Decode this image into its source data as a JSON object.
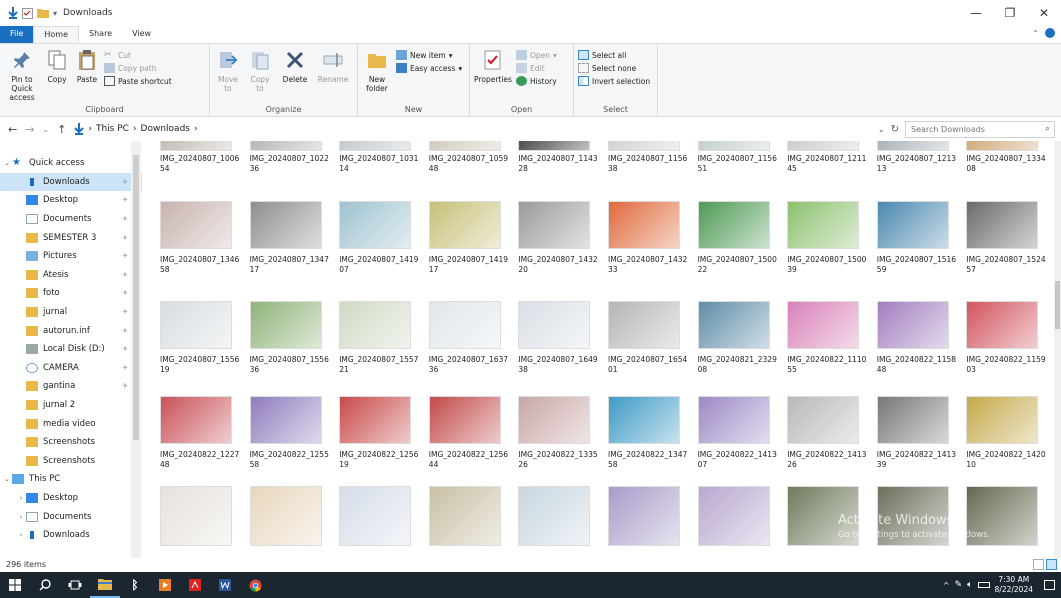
{
  "window": {
    "title": "Downloads"
  },
  "tabs": [
    "File",
    "Home",
    "Share",
    "View"
  ],
  "ribbon": {
    "clipboard": {
      "name": "Clipboard",
      "pin": "Pin to Quick access",
      "copy": "Copy",
      "paste": "Paste",
      "cut": "Cut",
      "copy_path": "Copy path",
      "paste_shortcut": "Paste shortcut"
    },
    "organize": {
      "name": "Organize",
      "move_to": "Move to",
      "copy_to": "Copy to",
      "delete": "Delete",
      "rename": "Rename"
    },
    "new": {
      "name": "New",
      "new_folder": "New folder",
      "new_item": "New item",
      "easy_access": "Easy access"
    },
    "open": {
      "name": "Open",
      "properties": "Properties",
      "open": "Open",
      "edit": "Edit",
      "history": "History"
    },
    "select": {
      "name": "Select",
      "select_all": "Select all",
      "select_none": "Select none",
      "invert_selection": "Invert selection"
    }
  },
  "address": {
    "path": [
      "This PC",
      "Downloads"
    ],
    "search_placeholder": "Search Downloads"
  },
  "nav_pane": [
    {
      "label": "Quick access",
      "icon": "star-icon",
      "level": 0,
      "expand": "v"
    },
    {
      "label": "Downloads",
      "icon": "download-icon",
      "level": 1,
      "pinned": true,
      "selected": true
    },
    {
      "label": "Desktop",
      "icon": "desktop-icon",
      "level": 1,
      "pinned": true
    },
    {
      "label": "Documents",
      "icon": "documents-icon",
      "level": 1,
      "pinned": true
    },
    {
      "label": "SEMESTER 3",
      "icon": "folder-icon",
      "level": 1,
      "pinned": true
    },
    {
      "label": "Pictures",
      "icon": "pictures-icon",
      "level": 1,
      "pinned": true
    },
    {
      "label": "Atesis",
      "icon": "folder-icon",
      "level": 1,
      "pinned": true
    },
    {
      "label": "foto",
      "icon": "folder-icon",
      "level": 1,
      "pinned": true
    },
    {
      "label": "jurnal",
      "icon": "folder-icon",
      "level": 1,
      "pinned": true
    },
    {
      "label": "autorun.inf",
      "icon": "folder-icon",
      "level": 1,
      "pinned": true
    },
    {
      "label": "Local Disk (D:)",
      "icon": "drive-icon",
      "level": 1,
      "pinned": true
    },
    {
      "label": "CAMERA",
      "icon": "search-folder-icon",
      "level": 1,
      "pinned": true
    },
    {
      "label": "gantina",
      "icon": "folder-icon",
      "level": 1,
      "pinned": true
    },
    {
      "label": "jurnal 2",
      "icon": "folder-icon",
      "level": 1
    },
    {
      "label": "media video",
      "icon": "folder-icon",
      "level": 1
    },
    {
      "label": "Screenshots",
      "icon": "folder-icon",
      "level": 1
    },
    {
      "label": "Screenshots",
      "icon": "folder-icon",
      "level": 1
    },
    {
      "label": "This PC",
      "icon": "pc-icon",
      "level": 0,
      "expand": "v"
    },
    {
      "label": "Desktop",
      "icon": "desktop-icon",
      "level": 1,
      "expand": ">"
    },
    {
      "label": "Documents",
      "icon": "documents-icon",
      "level": 1,
      "expand": ">"
    },
    {
      "label": "Downloads",
      "icon": "download-icon",
      "level": 1,
      "expand": ">"
    }
  ],
  "files": [
    {
      "row": [
        {
          "name": "IMG_20240807_100654",
          "color": "#b9b0a6"
        },
        {
          "name": "IMG_20240807_102236",
          "color": "#a9a9a9"
        },
        {
          "name": "IMG_20240807_103114",
          "color": "#b7bfc6"
        },
        {
          "name": "IMG_20240807_105948",
          "color": "#c8c2b0"
        },
        {
          "name": "IMG_20240807_114328",
          "color": "#2b2b2b"
        },
        {
          "name": "IMG_20240807_115638",
          "color": "#c7c9cc"
        },
        {
          "name": "IMG_20240807_115651",
          "color": "#b9c7c0"
        },
        {
          "name": "IMG_20240807_121145",
          "color": "#c3c3c3"
        },
        {
          "name": "IMG_20240807_121313",
          "color": "#9aa5ad"
        },
        {
          "name": "IMG_20240807_133408",
          "color": "#c79a62"
        }
      ]
    },
    {
      "row": [
        {
          "name": "IMG_20240807_134658",
          "color": "#c8b3ae"
        },
        {
          "name": "IMG_20240807_134717",
          "color": "#8e8e8e"
        },
        {
          "name": "IMG_20240807_141907",
          "color": "#9ec2cf"
        },
        {
          "name": "IMG_20240807_141917",
          "color": "#c7c078"
        },
        {
          "name": "IMG_20240807_143220",
          "color": "#9a9a9a"
        },
        {
          "name": "IMG_20240807_143233",
          "color": "#e06a3c"
        },
        {
          "name": "IMG_20240807_150022",
          "color": "#4e9a55"
        },
        {
          "name": "IMG_20240807_150039",
          "color": "#8cc06e"
        },
        {
          "name": "IMG_20240807_151659",
          "color": "#4c88b0"
        },
        {
          "name": "IMG_20240807_152457",
          "color": "#6a6a6a"
        }
      ]
    },
    {
      "row": [
        {
          "name": "IMG_20240807_155619",
          "color": "#d8dde0"
        },
        {
          "name": "IMG_20240807_155636",
          "color": "#8fb37a"
        },
        {
          "name": "IMG_20240807_155721",
          "color": "#cfd9c4"
        },
        {
          "name": "IMG_20240807_163736",
          "color": "#dfe6ea"
        },
        {
          "name": "IMG_20240807_164938",
          "color": "#d9dfe5"
        },
        {
          "name": "IMG_20240807_165401",
          "color": "#b5b5b5"
        },
        {
          "name": "IMG_20240821_232908",
          "color": "#5f8da8"
        },
        {
          "name": "IMG_20240822_111055",
          "color": "#d981b8"
        },
        {
          "name": "IMG_20240822_115848",
          "color": "#a07ec0"
        },
        {
          "name": "IMG_20240822_115903",
          "color": "#d2545e"
        }
      ]
    },
    {
      "row": [
        {
          "name": "IMG_20240822_122748",
          "color": "#c95258"
        },
        {
          "name": "IMG_20240822_125558",
          "color": "#8f7dbd"
        },
        {
          "name": "IMG_20240822_125619",
          "color": "#c94a4a"
        },
        {
          "name": "IMG_20240822_125644",
          "color": "#c24a4a"
        },
        {
          "name": "IMG_20240822_133526",
          "color": "#c8a6a6"
        },
        {
          "name": "IMG_20240822_134758",
          "color": "#3f9ac4"
        },
        {
          "name": "IMG_20240822_141307",
          "color": "#9c8ac6"
        },
        {
          "name": "IMG_20240822_141326",
          "color": "#b8b8b8"
        },
        {
          "name": "IMG_20240822_141339",
          "color": "#777777"
        },
        {
          "name": "IMG_20240822_142010",
          "color": "#c4a94a"
        }
      ]
    },
    {
      "row": [
        {
          "name": "",
          "color": "#e6e2dc"
        },
        {
          "name": "",
          "color": "#e8d7bd"
        },
        {
          "name": "",
          "color": "#d5dde8"
        },
        {
          "name": "",
          "color": "#c8c0a4"
        },
        {
          "name": "",
          "color": "#c8d6e0"
        },
        {
          "name": "",
          "color": "#a99cc9"
        },
        {
          "name": "",
          "color": "#b7a8cf"
        },
        {
          "name": "",
          "color": "#6f7a5c"
        },
        {
          "name": "",
          "color": "#6b705c"
        },
        {
          "name": "",
          "color": "#62694f"
        }
      ]
    }
  ],
  "status": {
    "count": "296 items"
  },
  "watermark": {
    "line1": "Activate Windows",
    "line2": "Go to Settings to activate Windows."
  },
  "taskbar": {
    "time": "7:30 AM",
    "date": "8/22/2024"
  },
  "colors": {
    "accent": "#1a6fc2",
    "selection": "#cce4f7",
    "taskbar": "#1c2631",
    "folder": "#e8b94a"
  }
}
